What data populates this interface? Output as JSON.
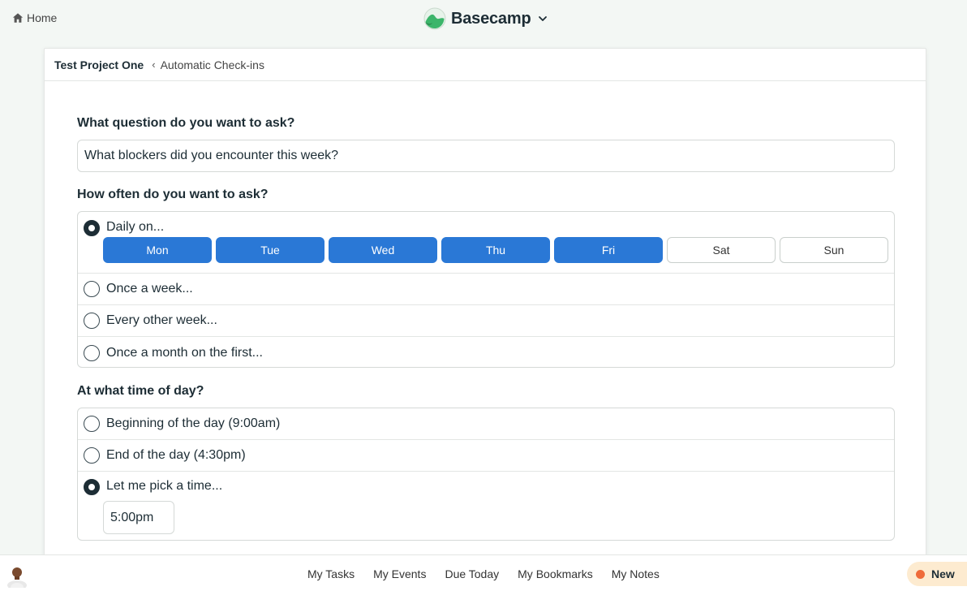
{
  "topnav": {
    "home_label": "Home",
    "brand_name": "Basecamp",
    "home_icon": "home-icon",
    "brand_icon": "basecamp-logo-icon",
    "chevron_icon": "chevron-down-icon"
  },
  "breadcrumb": {
    "project": "Test Project One",
    "separator": "‹",
    "current": "Automatic Check-ins"
  },
  "form": {
    "question_label": "What question do you want to ask?",
    "question_value": "What blockers did you encounter this week?",
    "frequency_label": "How often do you want to ask?",
    "frequency_options": [
      {
        "label": "Daily on...",
        "checked": true
      },
      {
        "label": "Once a week...",
        "checked": false
      },
      {
        "label": "Every other week...",
        "checked": false
      },
      {
        "label": "Once a month on the first...",
        "checked": false
      }
    ],
    "days": [
      {
        "label": "Mon",
        "selected": true
      },
      {
        "label": "Tue",
        "selected": true
      },
      {
        "label": "Wed",
        "selected": true
      },
      {
        "label": "Thu",
        "selected": true
      },
      {
        "label": "Fri",
        "selected": true
      },
      {
        "label": "Sat",
        "selected": false
      },
      {
        "label": "Sun",
        "selected": false
      }
    ],
    "time_label": "At what time of day?",
    "time_options": [
      {
        "label": "Beginning of the day (9:00am)",
        "checked": false
      },
      {
        "label": "End of the day (4:30pm)",
        "checked": false
      },
      {
        "label": "Let me pick a time...",
        "checked": true
      }
    ],
    "picked_time": "5:00pm"
  },
  "bottombar": {
    "links": [
      "My Tasks",
      "My Events",
      "Due Today",
      "My Bookmarks",
      "My Notes"
    ],
    "new_label": "New"
  },
  "colors": {
    "accent_blue": "#2a78d6",
    "new_badge_bg": "#fdebd0",
    "new_dot": "#ef6b3a"
  }
}
